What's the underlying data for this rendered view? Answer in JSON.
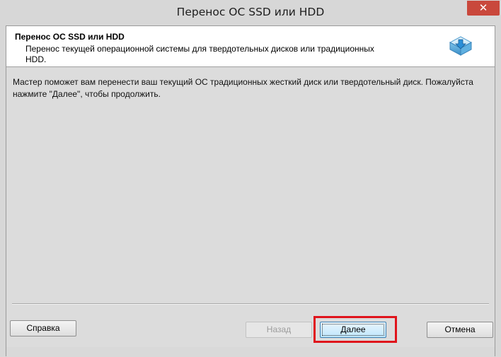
{
  "window": {
    "title": "Перенос ОС SSD или HDD",
    "close_glyph": "✕"
  },
  "header": {
    "title": "Перенос ОС SSD или HDD",
    "description": "Перенос текущей операционной системы для твердотельных дисков или традиционных HDD.",
    "icon": "download-disk-icon"
  },
  "body": {
    "message": "Мастер поможет вам перенести ваш текущий ОС традиционных жесткий диск или твердотельный диск. Пожалуйста нажмите \"Далее\", чтобы продолжить."
  },
  "buttons": {
    "help_label": "Справка",
    "back_label": "Назад",
    "next_label": "Далее",
    "cancel_label": "Отмена"
  },
  "colors": {
    "highlight": "#e0141c",
    "close": "#c9483c",
    "next_border": "#3c7fb1"
  }
}
